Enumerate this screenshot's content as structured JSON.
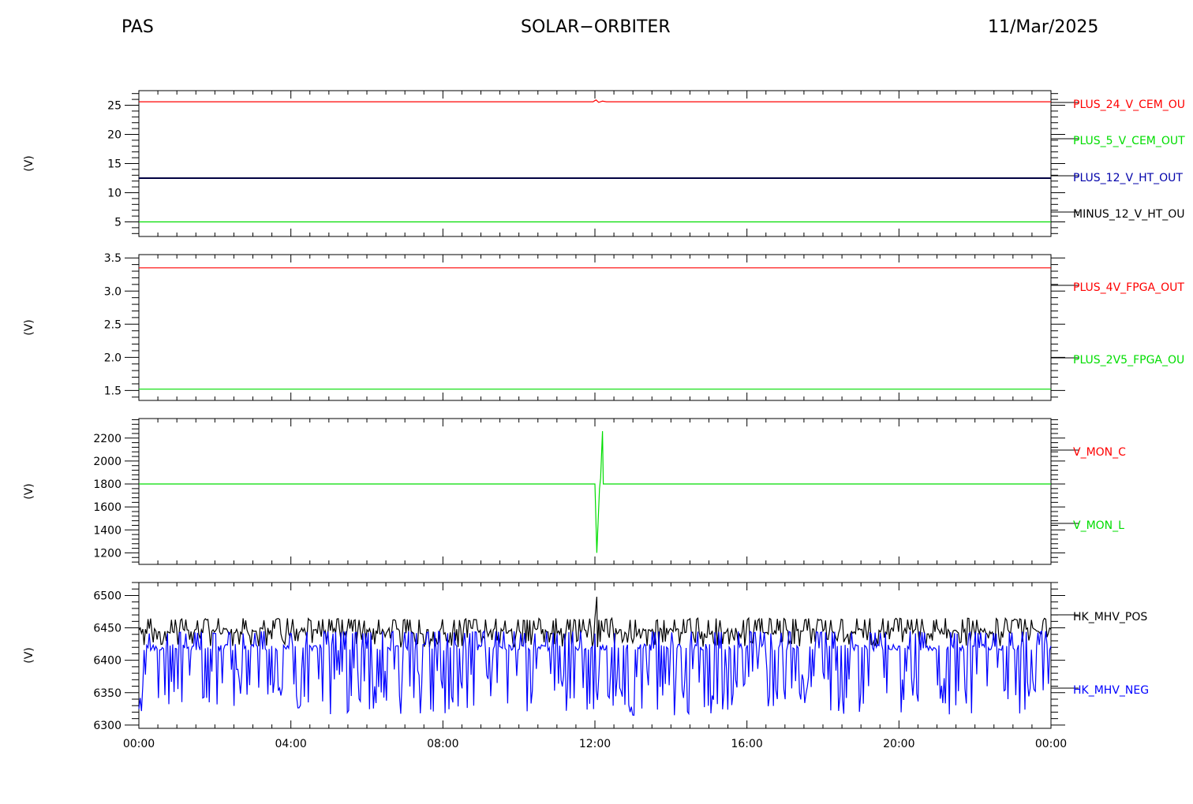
{
  "header": {
    "left": "PAS",
    "center": "SOLAR−ORBITER",
    "right": "11/Mar/2025"
  },
  "x_ticks": [
    "00:00",
    "04:00",
    "08:00",
    "12:00",
    "16:00",
    "20:00",
    "00:00"
  ],
  "chart_data": [
    {
      "type": "line",
      "ylabel": "(V)",
      "ylim": [
        2.5,
        27.5
      ],
      "yticks": [
        5,
        10,
        15,
        20,
        25
      ],
      "series": [
        {
          "name": "PLUS_24_V_CEM_OU",
          "color": "#ff0000",
          "points": [
            [
              0,
              25.6
            ],
            [
              11.95,
              25.6
            ],
            [
              12.03,
              25.9
            ],
            [
              12.1,
              25.5
            ],
            [
              12.2,
              25.7
            ],
            [
              12.3,
              25.6
            ],
            [
              24,
              25.6
            ]
          ]
        },
        {
          "name": "PLUS_5_V_CEM_OUT",
          "color": "#00dd00",
          "points": [
            [
              0,
              5.0
            ],
            [
              24,
              5.0
            ]
          ]
        },
        {
          "name": "PLUS_12_V_HT_OUT",
          "color": "#0000aa",
          "points": [
            [
              0,
              12.5
            ],
            [
              24,
              12.5
            ]
          ]
        },
        {
          "name": "MINUS_12_V_HT_OU",
          "color": "#000000",
          "points": [
            [
              0,
              12.5
            ],
            [
              24,
              12.5
            ]
          ]
        }
      ]
    },
    {
      "type": "line",
      "ylabel": "(V)",
      "ylim": [
        1.35,
        3.55
      ],
      "yticks": [
        "1.5",
        "2.0",
        "2.5",
        "3.0",
        "3.5"
      ],
      "series": [
        {
          "name": "PLUS_4V_FPGA_OUT",
          "color": "#ff0000",
          "points": [
            [
              0,
              3.35
            ],
            [
              24,
              3.35
            ]
          ]
        },
        {
          "name": "PLUS_2V5_FPGA_OU",
          "color": "#00dd00",
          "points": [
            [
              0,
              1.52
            ],
            [
              24,
              1.52
            ]
          ]
        }
      ]
    },
    {
      "type": "line",
      "ylabel": "(V)",
      "ylim": [
        1100,
        2370
      ],
      "yticks": [
        1200,
        1400,
        1600,
        1800,
        2000,
        2200
      ],
      "series": [
        {
          "name": "V_MON_C",
          "color": "#ff0000",
          "points": []
        },
        {
          "name": "V_MON_L",
          "color": "#00dd00",
          "points": [
            [
              0,
              1800
            ],
            [
              12.0,
              1800
            ],
            [
              12.05,
              1200
            ],
            [
              12.12,
              1760
            ],
            [
              12.15,
              1850
            ],
            [
              12.2,
              2260
            ],
            [
              12.22,
              1800
            ],
            [
              24,
              1800
            ]
          ]
        }
      ]
    },
    {
      "type": "line",
      "ylabel": "(V)",
      "ylim": [
        6295,
        6520
      ],
      "yticks": [
        6300,
        6350,
        6400,
        6450,
        6500
      ],
      "series": [
        {
          "name": "HK_MHV_POS",
          "color": "#000000",
          "base": 6445,
          "high": 6465,
          "low": 6420,
          "dip_prob": 0.25
        },
        {
          "name": "HK_MHV_NEG",
          "color": "#0000ff",
          "base": 6420,
          "high": 6445,
          "low": 6315,
          "dip_prob": 0.35
        }
      ]
    }
  ]
}
